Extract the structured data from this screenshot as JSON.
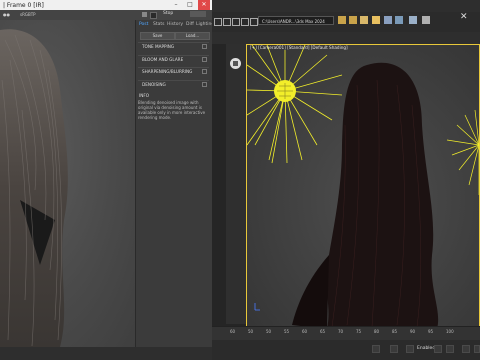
{
  "framebuffer": {
    "title": "| Frame 0 [IR]",
    "toolbar_left_label": "sRGBTP",
    "stop_label": "Stop",
    "tabs": [
      "Post",
      "Stats",
      "History",
      "Diff",
      "Lighting"
    ],
    "buttons": [
      "Save",
      "Load..."
    ],
    "sections": [
      "TONE MAPPING",
      "BLOOM AND GLARE",
      "SHARPENING/BLURRING",
      "DENOISING"
    ],
    "info_header": "INFO",
    "info_text": "Blending denoised image with original via denoising amount is available only in more interactive rendering mode."
  },
  "viewport": {
    "view_label": "[+] [Camera001] [Standard] [Default Shading]",
    "toolbar_field": "C:\\Users\\ANDR...\\3ds Max 2024",
    "timeline_ticks": [
      "60",
      "50",
      "50",
      "55",
      "60",
      "65",
      "70",
      "75",
      "80",
      "85",
      "90",
      "95",
      "100"
    ],
    "status_text": "Enabled"
  },
  "colors": {
    "light_yellow": "#f2ee2a",
    "frame_border": "#e8c83a"
  }
}
